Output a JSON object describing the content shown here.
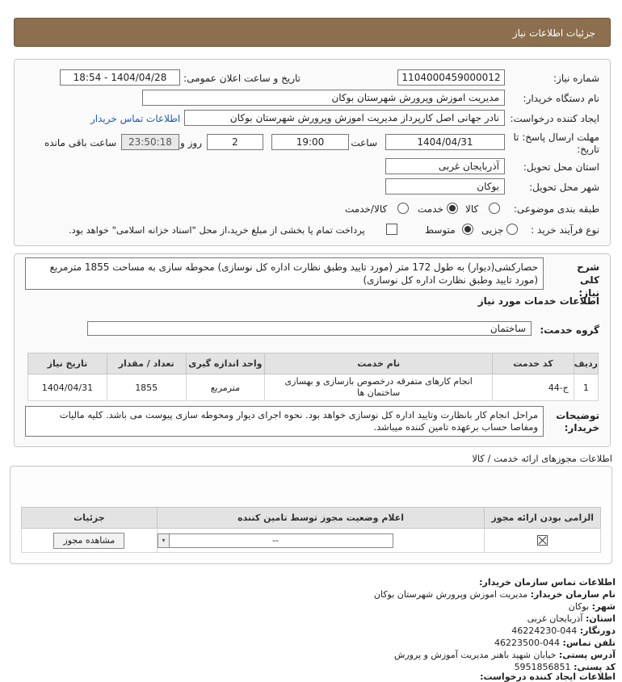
{
  "header": {
    "title": "جزئیات اطلاعات نیاز"
  },
  "form": {
    "need_number_label": "شماره نیاز:",
    "need_number": "1104000459000012",
    "announce_label": "تاریخ و ساعت اعلان عمومی:",
    "announce_value": "1404/04/28 - 18:54",
    "buyer_org_label": "نام دستگاه خریدار:",
    "buyer_org": "مدیریت اموزش وپرورش شهرستان بوکان",
    "creator_label": "ایجاد کننده درخواست:",
    "creator": "نادر جهانی اصل کارپرداز مدیریت اموزش وپرورش شهرستان بوکان",
    "contact_link": "اطلاعات تماس خریدار",
    "deadline_label_1": "مهلت ارسال پاسخ: تا",
    "deadline_label_2": "تاریخ:",
    "deadline_date": "1404/04/31",
    "time_label": "ساعت",
    "deadline_time": "19:00",
    "days_value": "2",
    "days_label": "روز و",
    "remaining_time": "23:50:18",
    "remaining_label": "ساعت باقی مانده",
    "province_label": "استان محل تحویل:",
    "province": "آذربایجان غربی",
    "city_label": "شهر محل تحویل:",
    "city": "بوکان",
    "category_label": "طبقه بندی موضوعی:",
    "category_options": [
      "کالا",
      "خدمت",
      "کالا/خدمت"
    ],
    "process_label": "نوع فرآیند خرید :",
    "process_options": [
      "جزیی",
      "متوسط"
    ],
    "payment_note": "پرداخت تمام یا بخشی از مبلغ خرید،از محل \"اسناد خزانه اسلامی\" خواهد بود."
  },
  "summary": {
    "label": "شرح کلی نیاز:",
    "text": "حصارکشی(دیوار) به طول 172 متر (مورد تایید وطبق نظارت اداره کل نوسازی) محوطه سازی به مساحت 1855 مترمربع (مورد تایید وطبق نظارت اداره کل نوسازی)"
  },
  "services": {
    "section_title": "اطلاعات خدمات مورد نیاز",
    "group_label": "گروه خدمت:",
    "group_value": "ساختمان",
    "columns": [
      "ردیف",
      "کد خدمت",
      "نام خدمت",
      "واحد اندازه گیری",
      "تعداد / مقدار",
      "تاریخ نیاز"
    ],
    "rows": [
      {
        "index": "1",
        "code": "ج-44",
        "name": "انجام کارهای متفرقه درخصوص بازسازی و بهسازی ساختمان ها",
        "unit": "مترمربع",
        "quantity": "1855",
        "date": "1404/04/31"
      }
    ]
  },
  "buyer_notes": {
    "label_1": "توضیحات",
    "label_2": "خریدار:",
    "text": "مراحل انجام کار بانظارت وتایید اداره کل نوسازی خواهد بود. نحوه اجرای دیوار ومحوطه سازی پیوست می باشد. کلیه مالیات ومفاصا حساب برعهده تامین کننده میباشد."
  },
  "permits": {
    "section_title": "اطلاعات مجوزهای ارائه خدمت / کالا",
    "columns": [
      "الزامی بودن ارائه مجوز",
      "اعلام وضعیت مجوز توسط تامین کننده",
      "جزئیات"
    ],
    "select_value": "--",
    "view_button": "مشاهده مجوز"
  },
  "contact": {
    "title": "اطلاعات تماس سازمان خریدار:",
    "org_label": "نام سازمان خریدار:",
    "org": "مدیریت اموزش وپرورش شهرستان بوکان",
    "city_label": "شهر:",
    "city": "بوکان",
    "province_label": "استان:",
    "province": "آذربایجان غربی",
    "fax_label": "دورنگار:",
    "fax": "044-46224230",
    "phone_label": "تلفن تماس:",
    "phone": "044-46223500",
    "address_label": "آدرس پستی:",
    "address": "خیابان شهید باهنر مدیریت آموزش و پرورش",
    "postal_label": "کد پستی:",
    "postal": "5951856851",
    "creator_title": "اطلاعات ایجاد کننده درخواست:"
  },
  "colors": {
    "header": "#8b6f4f",
    "link": "#1a5fb4"
  }
}
